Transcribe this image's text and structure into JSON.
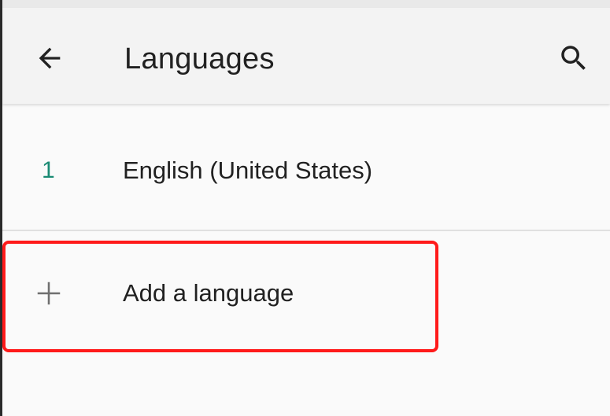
{
  "app_bar": {
    "title": "Languages",
    "back_icon": "arrow-back-icon",
    "search_icon": "search-icon"
  },
  "languages": [
    {
      "number": "1",
      "name": "English (United States)"
    }
  ],
  "add_language": {
    "label": "Add a language",
    "icon": "plus-icon"
  },
  "colors": {
    "accent": "#1a8a73",
    "highlight": "#ff1a1a",
    "text": "#212121"
  }
}
